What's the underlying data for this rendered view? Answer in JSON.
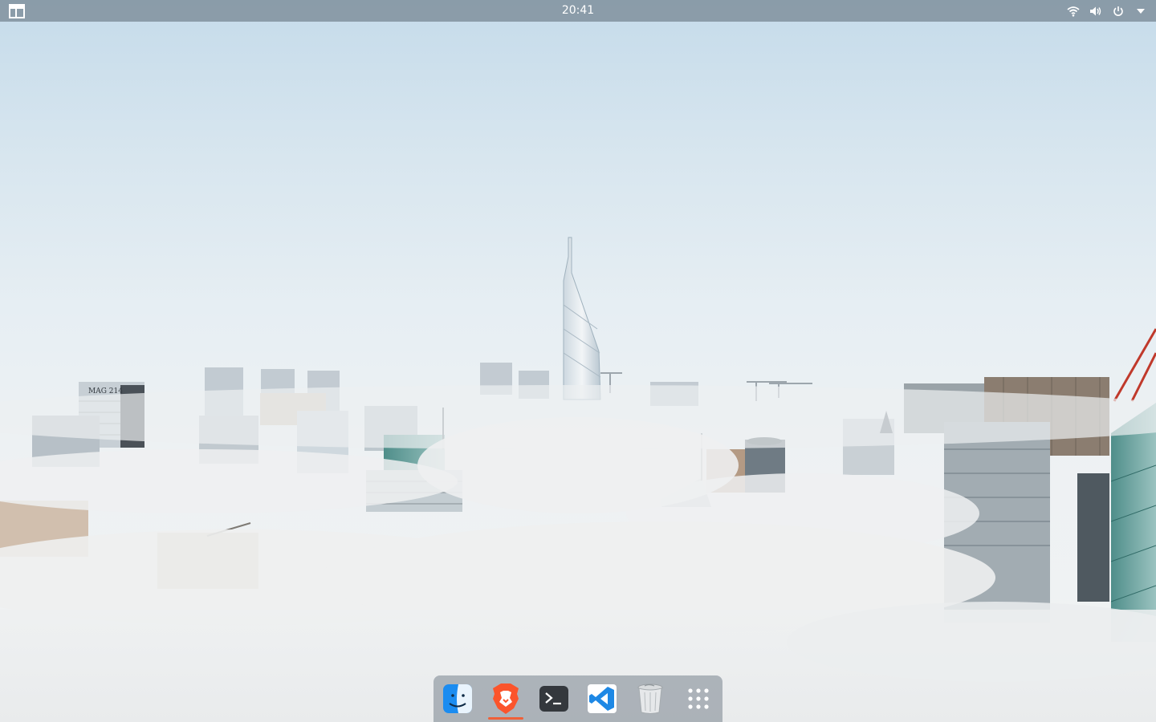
{
  "top_panel": {
    "clock": "20:41",
    "activities_icon": "activities-icon",
    "tray_icons": [
      "wifi-icon",
      "volume-icon",
      "power-icon",
      "chevron-down-icon"
    ]
  },
  "dock": {
    "items": [
      {
        "name": "finder-icon",
        "running": false
      },
      {
        "name": "brave-browser-icon",
        "running": true
      },
      {
        "name": "terminal-icon",
        "running": false
      },
      {
        "name": "vscode-icon",
        "running": false
      },
      {
        "name": "trash-icon",
        "running": false
      },
      {
        "name": "app-grid-icon",
        "running": false
      }
    ]
  },
  "wallpaper": {
    "building_sign": "MAG 214"
  },
  "colors": {
    "panel": "#7a8a96",
    "accent_indicator": "#f06038",
    "brave": "#fb542b",
    "vscode": "#1e88e5"
  }
}
